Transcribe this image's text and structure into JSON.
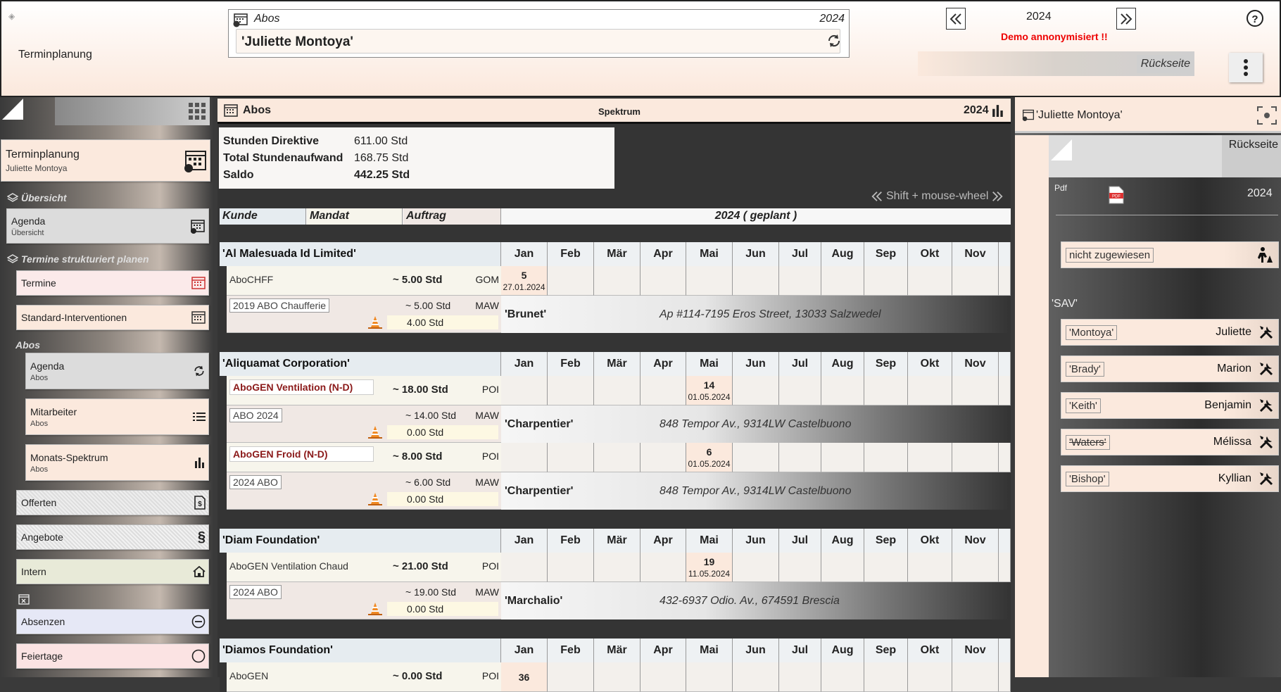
{
  "header": {
    "app_title": "Terminplanung",
    "box_title": "Abos",
    "box_year": "2024",
    "person": "'Juliette Montoya'",
    "year": "2024",
    "demo": "Demo annonymisiert !!",
    "rueckseite": "Rückseite"
  },
  "left": {
    "top_item": {
      "label": "Terminplanung",
      "sub": "Juliette Montoya"
    },
    "sec_overview": "Übersicht",
    "agenda": {
      "label": "Agenda",
      "sub": "Übersicht"
    },
    "sec_plan": "Termine strukturiert planen",
    "termine": "Termine",
    "standard": "Standard-Interventionen",
    "sec_abos": "Abos",
    "abos_agenda": {
      "label": "Agenda",
      "sub": "Abos"
    },
    "mitarbeiter": {
      "label": "Mitarbeiter",
      "sub": "Abos"
    },
    "spektrum": {
      "label": "Monats-Spektrum",
      "sub": "Abos"
    },
    "offerten": "Offerten",
    "angebote": "Angebote",
    "intern": "Intern",
    "absenzen": "Absenzen",
    "feiertage": "Feiertage"
  },
  "main": {
    "title": "Abos",
    "center": "Spektrum",
    "year": "2024",
    "summary": [
      {
        "k": "Stunden Direktive",
        "v": "611.00 Std"
      },
      {
        "k": "Total Stundenaufwand",
        "v": "168.75 Std"
      },
      {
        "k": "Saldo",
        "v": "442.25 Std"
      }
    ],
    "shift_hint": "Shift + mouse-wheel",
    "cols": {
      "kunde": "Kunde",
      "mandat": "Mandat",
      "auftrag": "Auftrag",
      "plan": "2024 ( geplant )"
    },
    "months": [
      "Jan",
      "Feb",
      "Mär",
      "Apr",
      "Mai",
      "Jun",
      "Jul",
      "Aug",
      "Sep",
      "Okt",
      "Nov"
    ],
    "customers": [
      {
        "name": "'Al Malesuada Id Limited'",
        "jobs": [
          {
            "name": "AboCHFF",
            "hours": "~ 5.00 Std",
            "code": "GOM",
            "red": false,
            "month": 0,
            "count": "5",
            "date": "27.01.2024",
            "sub": {
              "tag": "2019 ABO Chaufferie",
              "planned": "~ 5.00 Std",
              "code": "MAW",
              "done": "4.00 Std",
              "worker": "'Brunet'",
              "addr": "Ap #114-7195 Eros Street, 13033 Salzwedel"
            }
          }
        ]
      },
      {
        "name": "'Aliquamat Corporation'",
        "jobs": [
          {
            "name": "AboGEN Ventilation (N-D)",
            "hours": "~ 18.00 Std",
            "code": "POI",
            "red": true,
            "month": 4,
            "count": "14",
            "date": "01.05.2024",
            "sub": {
              "tag": "ABO 2024",
              "planned": "~ 14.00 Std",
              "code": "MAW",
              "done": "0.00 Std",
              "worker": "'Charpentier'",
              "addr": "848 Tempor Av., 9314LW Castelbuono"
            }
          },
          {
            "name": "AboGEN Froid (N-D)",
            "hours": "~ 8.00 Std",
            "code": "POI",
            "red": true,
            "month": 4,
            "count": "6",
            "date": "01.05.2024",
            "sub": {
              "tag": "2024 ABO",
              "planned": "~ 6.00 Std",
              "code": "MAW",
              "done": "0.00 Std",
              "worker": "'Charpentier'",
              "addr": "848 Tempor Av., 9314LW Castelbuono"
            }
          }
        ]
      },
      {
        "name": "'Diam Foundation'",
        "jobs": [
          {
            "name": "AboGEN Ventilation Chaud",
            "hours": "~ 21.00 Std",
            "code": "POI",
            "red": false,
            "month": 4,
            "count": "19",
            "date": "11.05.2024",
            "sub": {
              "tag": "2024 ABO",
              "planned": "~ 19.00 Std",
              "code": "MAW",
              "done": "0.00 Std",
              "worker": "'Marchalio'",
              "addr": "432-6937 Odio. Av., 674591 Brescia"
            }
          }
        ]
      },
      {
        "name": "'Diamos Foundation'",
        "jobs": [
          {
            "name": "AboGEN",
            "hours": "~ 0.00 Std",
            "code": "POI",
            "red": false,
            "month": 0,
            "count": "36",
            "date": "",
            "sub": null
          }
        ]
      }
    ]
  },
  "right": {
    "title": "'Juliette Montoya'",
    "rueckseite": "Rückseite",
    "pdf": "Pdf",
    "year": "2024",
    "unassigned": "nicht zugewiesen",
    "group": "'SAV'",
    "workers": [
      {
        "last": "'Montoya'",
        "first": "Juliette",
        "strike": false
      },
      {
        "last": "'Brady'",
        "first": "Marion",
        "strike": false
      },
      {
        "last": "'Keith'",
        "first": "Benjamin",
        "strike": false
      },
      {
        "last": "'Waters'",
        "first": "Mélissa",
        "strike": true
      },
      {
        "last": "'Bishop'",
        "first": "Kyllian",
        "strike": false
      }
    ]
  }
}
